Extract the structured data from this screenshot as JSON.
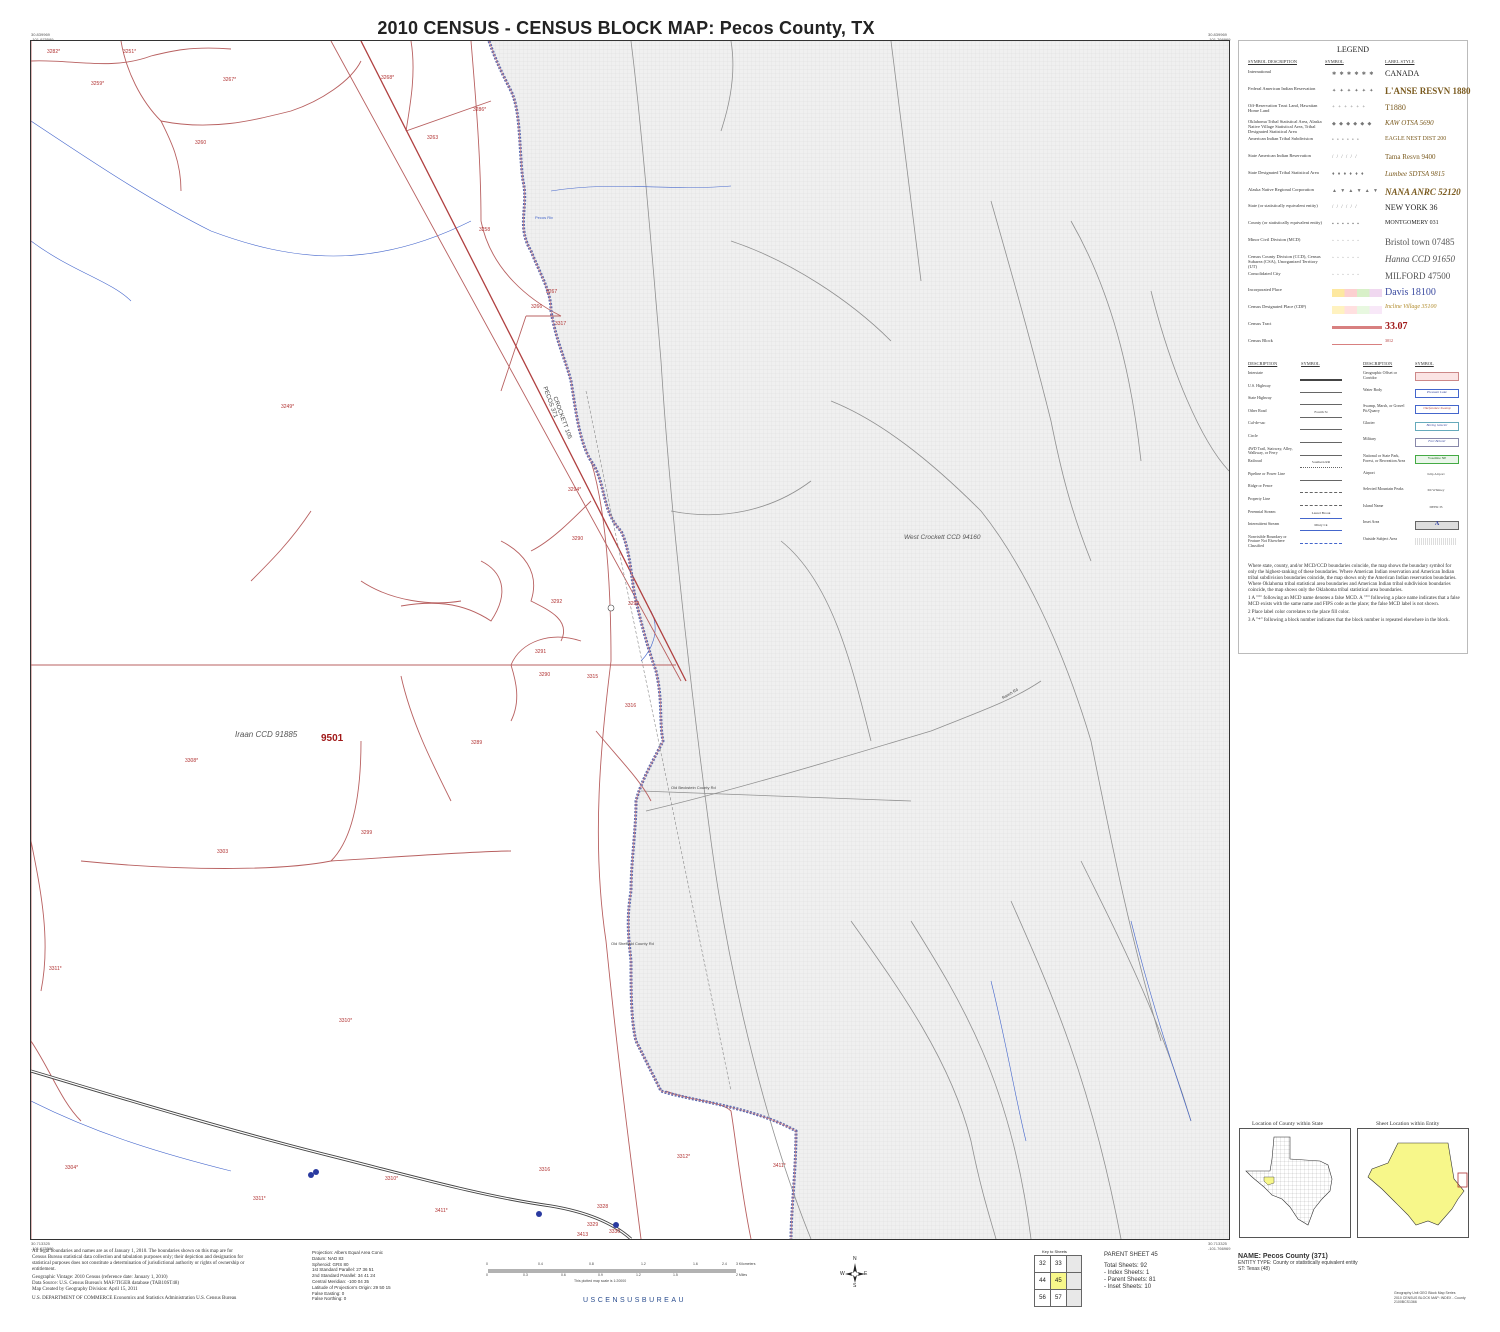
{
  "title": "2010 CENSUS - CENSUS BLOCK MAP:  Pecos County, TX",
  "map": {
    "corner_nw": [
      "30.839969",
      "-101.975589"
    ],
    "corner_ne": [
      "30.839969",
      "-101.766969"
    ],
    "corner_sw": [
      "30.713325",
      "-101.975589"
    ],
    "corner_se": [
      "30.713325",
      "-101.766969"
    ],
    "ccd_west": "Iraan CCD 91885",
    "ccd_east": "West Crockett CCD 94160",
    "tract": "9501",
    "county_road_label_1": "CROCKETT 105",
    "county_road_label_2": "PECOS 371",
    "stream_1": "Pecos Riv",
    "road_1": "Old Sheffield County Rd",
    "road_2": "Old Beckstein County Rd",
    "road_3": "Ranch Rd",
    "blocks": [
      "3282*",
      "3251*",
      "3259*",
      "3267*",
      "3268*",
      "3260",
      "3263",
      "3286*",
      "3258",
      "3267",
      "3266",
      "3317",
      "3249*",
      "3294*",
      "3290",
      "3293",
      "3292",
      "3291",
      "3290",
      "3315",
      "3316",
      "3289",
      "3308*",
      "3299",
      "3303",
      "3311*",
      "3310*",
      "3304*",
      "3311*",
      "3310*",
      "3316",
      "3312*",
      "3411*",
      "3411*",
      "3328",
      "3329",
      "3330",
      "3413"
    ]
  },
  "legend": {
    "title": "LEGEND",
    "col_desc": "SYMBOL DESCRIPTION",
    "col_sym": "SYMBOL",
    "col_label": "LABEL STYLE",
    "rows": [
      {
        "desc": "International",
        "sym": "✱ ✱ ✱ ✱ ✱ ✱",
        "label": "CANADA",
        "color": "#222",
        "style": "normal",
        "weight": "normal",
        "size": "8"
      },
      {
        "desc": "Federal American Indian Reservation",
        "sym": "✦ ✦ ✦ ✦ ✦ ✦",
        "label": "L'ANSE RESVN 1880",
        "color": "#7a5a1e",
        "style": "normal",
        "weight": "bold",
        "size": "9"
      },
      {
        "desc": "Off-Reservation Trust Land, Hawaiian Home Land",
        "sym": "+ + + + + +",
        "label": "T1880",
        "color": "#7a5a1e",
        "style": "normal",
        "weight": "normal",
        "size": "8"
      },
      {
        "desc": "Oklahoma Tribal Statistical Area, Alaska Native Village Statistical Area, Tribal Designated Statistical Area",
        "sym": "◆ ◆ ◆ ◆ ◆ ◆",
        "label": "KAW OTSA 5690",
        "color": "#7a5a1e",
        "style": "italic",
        "weight": "normal",
        "size": "7"
      },
      {
        "desc": "American Indian Tribal Subdivision",
        "sym": "• • • • • •",
        "label": "EAGLE NEST DIST 200",
        "color": "#7a5a1e",
        "style": "normal",
        "weight": "normal",
        "size": "6"
      },
      {
        "desc": "State American Indian Reservation",
        "sym": "/ / / / / /",
        "label": "Tama Resvn 9400",
        "color": "#7a5a1e",
        "style": "normal",
        "weight": "normal",
        "size": "7"
      },
      {
        "desc": "State Designated Tribal Statistical Area",
        "sym": "♦ ♦ ♦ ♦ ♦ ♦",
        "label": "Lumbee SDTSA 9815",
        "color": "#7a5a1e",
        "style": "italic",
        "weight": "normal",
        "size": "7"
      },
      {
        "desc": "Alaska Native Regional Corporation",
        "sym": "▲ ▼ ▲ ▼ ▲ ▼",
        "label": "NANA ANRC 52120",
        "color": "#7a5a1e",
        "style": "italic",
        "weight": "bold",
        "size": "9"
      },
      {
        "desc": "State (or statistically equivalent entity)",
        "sym": "/ / / / / /",
        "label": "NEW YORK 36",
        "color": "#222",
        "style": "normal",
        "weight": "normal",
        "size": "8"
      },
      {
        "desc": "County (or statistically equivalent entity)",
        "sym": "▪ ▪ ▪ ▪ ▪ ▪",
        "label": "MONTGOMERY 031",
        "color": "#222",
        "style": "normal",
        "weight": "normal",
        "size": "6"
      },
      {
        "desc": "Minor Civil Division (MCD)",
        "sym": "◦ ◦ ◦ ◦ ◦ ◦",
        "label": "Bristol town 07485",
        "color": "#555",
        "style": "normal",
        "weight": "normal",
        "size": "9"
      },
      {
        "desc": "Census County Division (CCD), Census Subarea (CSA), Unorganized Territory (UT)",
        "sym": "◦ ◦ ◦ ◦ ◦ ◦",
        "label": "Hanna CCD 91650",
        "color": "#555",
        "style": "italic",
        "weight": "normal",
        "size": "9"
      },
      {
        "desc": "Consolidated City",
        "sym": "◦ ◦ ◦ ◦ ◦ ◦",
        "label": "MILFORD 47500",
        "color": "#555",
        "style": "normal",
        "weight": "normal",
        "size": "9"
      },
      {
        "desc": "Incorporated Place",
        "sym": "",
        "label": "Davis 18100",
        "color": "#3a4aa0",
        "style": "normal",
        "weight": "normal",
        "size": "10"
      },
      {
        "desc": "Census Designated Place (CDP)",
        "sym": "",
        "label": "Incline Village 35100",
        "color": "#b08a2a",
        "style": "italic",
        "weight": "normal",
        "size": "6"
      },
      {
        "desc": "Census Tract",
        "sym": "",
        "label": "33.07",
        "color": "#a01818",
        "style": "normal",
        "weight": "bold",
        "size": "10"
      },
      {
        "desc": "Census Block",
        "sym": "",
        "label": "3012",
        "color": "#b03030",
        "style": "normal",
        "weight": "normal",
        "size": "4"
      }
    ],
    "col2_desc": "DESCRIPTION",
    "col2_sym": "SYMBOL",
    "left_rows": [
      "Interstate",
      "U.S. Highway",
      "State Highway",
      "Other Road",
      "Cul-de-sac",
      "Circle",
      "4WD Trail, Stairway, Alley, Walkway, or Ferry",
      "Railroad",
      "Pipeline or Power Line",
      "Ridge or Fence",
      "Property Line",
      "Perennial Stream",
      "Intermittent Stream",
      "Nonvisible Boundary or Feature Not Elsewhere Classified"
    ],
    "left_syms": [
      "",
      "",
      "",
      "Fourth St",
      "",
      "",
      "",
      "Southern RR",
      "",
      "",
      "",
      "Laurel Brook",
      "Misty Ck",
      ""
    ],
    "right_rows": [
      "Geographic Offset or Corridor",
      "Water Body",
      "Swamp, Marsh, or Gravel Pit/Quarry",
      "Glacier",
      "Military",
      "National or State Park, Forest, or Recreation Area",
      "Airport",
      "Selected Mountain Peaks",
      "Island Name",
      "Inset Area",
      "Outside Subject Area"
    ],
    "right_syms": [
      "",
      "Pleasant Lake",
      "Okefenokee Swamp",
      "Bering Glacier",
      "Fort Belvoir",
      "Yosemite NP",
      "Islip Airport",
      "Mt Whitney",
      "DEER IS",
      "A",
      ""
    ],
    "notes": [
      "Where state, county, and/or MCD/CCD boundaries coincide, the map shows the boundary symbol for only the highest-ranking of these boundaries.  Where American Indian reservation and American Indian tribal subdivision boundaries coincide, the map shows only the American Indian reservation boundaries.  Where Oklahoma tribal statistical area boundaries and American Indian tribal subdivision boundaries coincide, the map shows only the Oklahoma tribal statistical area boundaries.",
      "1  A \"°\" following an MCD name denotes a false MCD.  A \"°\" following a place name indicates that a false MCD exists with the same name and FIPS code as the place; the false MCD label is not shown.",
      "2  Place label color correlates to the place fill color.",
      "3  A \"*\" following a block number indicates that the block number is repeated elsewhere in the block."
    ]
  },
  "location_state_label": "Location of County within State",
  "location_entity_label": "Sheet Location within Entity",
  "footer": {
    "disclaimer": "All legal boundaries and names are as of January 1, 2010. The boundaries shown on this map are for Census Bureau statistical data collection and tabulation purposes only; their depiction and designation for statistical purposes does not constitute a determination of jurisdictional authority or rights of ownership or entitlement.",
    "vintage": "Geographic Vintage: 2010 Census (reference date: January 1, 2010)",
    "source": "Data Source: U.S. Census Bureau's MAF/TIGER database (TAB10ST48)",
    "created": "Map Created by Geography Division: April 15, 2011",
    "dept": "U.S. DEPARTMENT OF COMMERCE Economics and Statistics Administration U.S. Census Bureau",
    "projection": [
      "Projection: Albers Equal Area Conic",
      "Datum: NAD 83",
      "Spheroid: GRS 80",
      "1st Standard Parallel: 27 36 51",
      "2nd Standard Parallel: 34 41 24",
      "Central Meridian: -100 04 35",
      "Latitude of Projection's Origin: 29 50 15",
      "False Easting: 0",
      "False Northing: 0"
    ],
    "scale_km": [
      "0",
      "0.4",
      "0.8",
      "1.2",
      "1.6",
      "2.4",
      "3 Kilometers"
    ],
    "scale_mi": [
      "0",
      "0.3",
      "0.6",
      "0.9",
      "1.2",
      "1.5",
      "2 Miles"
    ],
    "scale_note": "This plotted map scale is 1:20000",
    "census_bureau": "USCENSUSBUREAU",
    "compass": {
      "n": "N",
      "s": "S",
      "e": "E",
      "w": "W"
    },
    "key_title": "Key to Sheets",
    "key_grid": [
      [
        "32",
        "33",
        ""
      ],
      [
        "44",
        "45",
        ""
      ],
      [
        "56",
        "57",
        ""
      ]
    ],
    "parent_sheet": "PARENT SHEET 45",
    "total_sheets": "Total Sheets: 92",
    "index_sheets": "- Index Sheets: 1",
    "parent_sheets": "- Parent Sheets: 81",
    "inset_sheets": "- Inset Sheets: 10",
    "entity_name": "NAME: Pecos County (371)",
    "entity_type": "ENTITY TYPE: County or statistically equivalent entity",
    "entity_state": "ST: Texas (48)",
    "series_1": "Geography Unit GEO Block Map Series",
    "series_2": "2010 CENSUS BLOCK MAP: INDEX - County",
    "series_3": "2100BCS1366"
  },
  "colors": {
    "tract_boundary": "#b04040",
    "block_line": "#b86060",
    "stream": "#4466cc",
    "county_boundary": "#5a6ab0",
    "road": "#888888",
    "outside_fill": "#efefef",
    "entity_fill": "#f7f78a"
  }
}
